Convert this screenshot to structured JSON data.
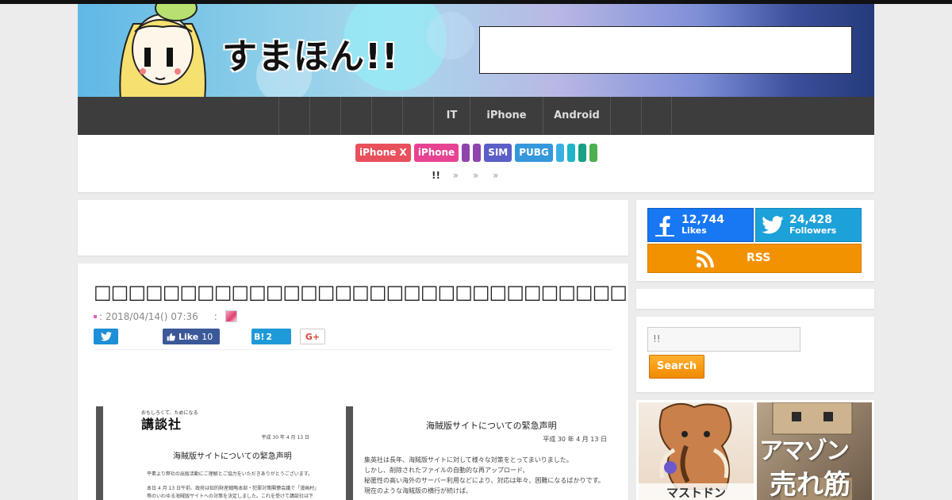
{
  "site": {
    "logo_text": "すまほん!!"
  },
  "nav": {
    "items": [
      {
        "label": ""
      },
      {
        "label": ""
      },
      {
        "label": ""
      },
      {
        "label": ""
      },
      {
        "label": ""
      },
      {
        "label": "IT"
      },
      {
        "label": "iPhone"
      },
      {
        "label": "Android"
      },
      {
        "label": ""
      },
      {
        "label": ""
      }
    ]
  },
  "tags": [
    {
      "label": "iPhone X",
      "color": "#e8505b"
    },
    {
      "label": "iPhone",
      "color": "#e84393"
    },
    {
      "label": "",
      "color": "#8e44ad"
    },
    {
      "label": "",
      "color": "#8e44ad"
    },
    {
      "label": "SIM",
      "color": "#5b5fc7"
    },
    {
      "label": "PUBG",
      "color": "#3498db"
    },
    {
      "label": "",
      "color": "#3ab0e2"
    },
    {
      "label": "",
      "color": "#1fb5c9"
    },
    {
      "label": "",
      "color": "#16a085"
    },
    {
      "label": "",
      "color": "#4caf50"
    }
  ],
  "breadcrumb": {
    "home": "!!",
    "sep1": "»",
    "sep2": "»",
    "sep3": "»"
  },
  "article": {
    "title": "□□□□□□□□□□□□□□□□□□□□□□□□□□□□□□□□□□□□□□□□□□□□□□□",
    "date": ": 2018/04/14() 07:36",
    "author_label": ":",
    "share": {
      "facebook_label": "Like",
      "facebook_count": "10",
      "hatena_label": "B!",
      "hatena_count": "2",
      "gplus_label": "G+"
    },
    "doc_left": {
      "brand_small": "おもしろくて、ためになる",
      "brand": "講談社",
      "date": "平成 30 年 4 月 13 日",
      "heading": "海賊版サイトについての緊急声明",
      "lines": [
        "平素より弊社の出版活動にご理解とご協力をいただきありがとうございます。",
        "本日 4 月 13 日午前、政府は知的財産戦略本部・犯罪対策閣僚会議で「漫画村」",
        "等のいわゆる海賊版サイトへの対策を決定しました。これを受けて講談社は下"
      ]
    },
    "doc_right": {
      "heading": "海賊版サイトについての緊急声明",
      "date": "平成 30 年 4 月 13 日",
      "lines": [
        "集英社は長年、海賊版サイトに対して様々な対策をとってまいりました。",
        "しかし、削除されたファイルの自動的な再アップロード、",
        "秘匿性の高い海外のサーバー利用などにより、対応は年々、困難になるばかりです。",
        "現在のような海賊版の横行が続けば、"
      ]
    }
  },
  "sidebar": {
    "facebook": {
      "count": "12,744",
      "label": "Likes"
    },
    "twitter": {
      "count": "24,428",
      "label": "Followers"
    },
    "rss_label": "RSS",
    "search": {
      "value": "!!",
      "button": "Search"
    },
    "banner1_caption": "マストドン",
    "banner2_line1": "アマゾン",
    "banner2_line2": "売れ筋"
  }
}
